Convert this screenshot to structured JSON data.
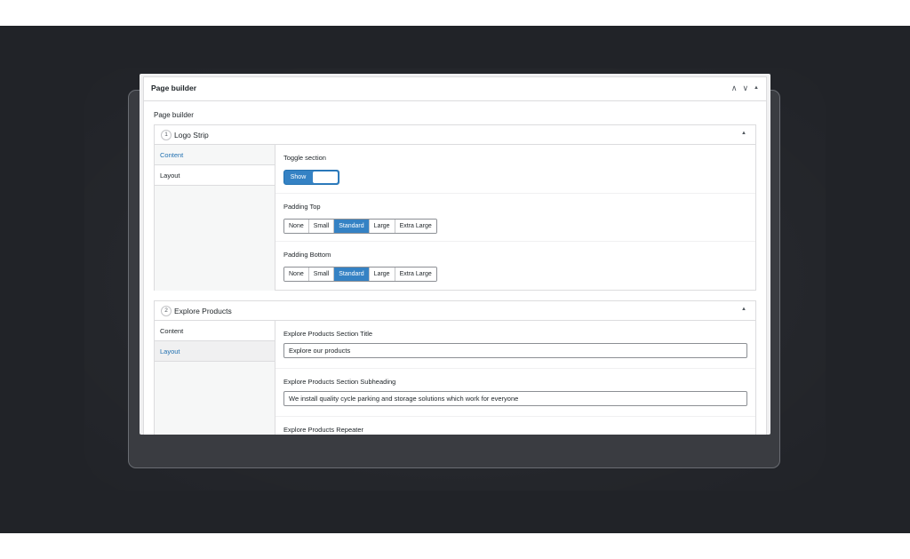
{
  "metabox": {
    "title": "Page builder",
    "controls": [
      "∧",
      "∨",
      "▲"
    ]
  },
  "field_label": "Page builder",
  "blocks": [
    {
      "index": "1",
      "title": "Logo Strip",
      "toggle": "▲",
      "tabs": [
        {
          "label": "Content",
          "state": "link"
        },
        {
          "label": "Layout",
          "state": "active"
        }
      ],
      "toggle_section": {
        "label": "Toggle section",
        "value": "Show"
      },
      "padding_top": {
        "label": "Padding Top",
        "options": [
          "None",
          "Small",
          "Standard",
          "Large",
          "Extra Large"
        ],
        "selected": "Standard"
      },
      "padding_bottom": {
        "label": "Padding Bottom",
        "options": [
          "None",
          "Small",
          "Standard",
          "Large",
          "Extra Large"
        ],
        "selected": "Standard"
      }
    },
    {
      "index": "2",
      "title": "Explore Products",
      "toggle": "▲",
      "tabs": [
        {
          "label": "Content",
          "state": "active"
        },
        {
          "label": "Layout",
          "state": "link"
        }
      ],
      "section_title": {
        "label": "Explore Products Section Title",
        "value": "Explore our products"
      },
      "section_subheading": {
        "label": "Explore Products Section Subheading",
        "value": "We install quality cycle parking and storage solutions which work for everyone"
      },
      "repeater": {
        "label": "Explore Products Repeater"
      }
    }
  ],
  "colors": {
    "accent": "#3582c4",
    "link": "#2271b1",
    "background": "#212328"
  }
}
